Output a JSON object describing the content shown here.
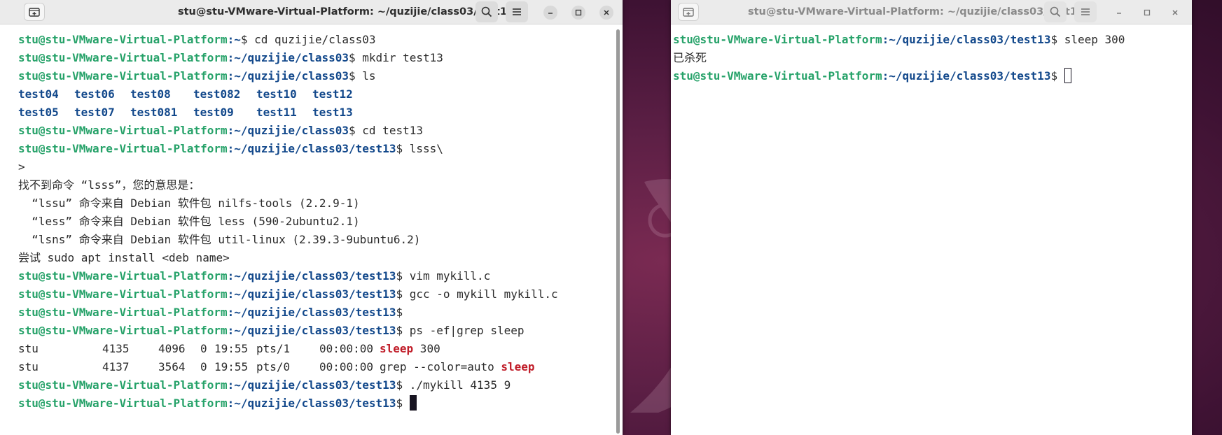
{
  "left_window": {
    "title": "stu@stu-VMware-Virtual-Platform: ~/quzijie/class03/test13",
    "prompt_user": "stu@stu-VMware-Virtual-Platform",
    "lines": {
      "l1_path": ":~",
      "l1_cmd": "$ cd quzijie/class03",
      "l2_path": ":~/quzijie/class03",
      "l2_cmd": "$ mkdir test13",
      "l3_path": ":~/quzijie/class03",
      "l3_cmd": "$ ls",
      "l6_path": ":~/quzijie/class03",
      "l6_cmd": "$ cd test13",
      "l7_path": ":~/quzijie/class03/test13",
      "l7_cmd": "$ lsss\\",
      "l8": ">",
      "l9": "找不到命令 “lsss”，您的意思是：",
      "l10": "  “lssu” 命令来自 Debian 软件包 nilfs-tools (2.2.9-1)",
      "l11": "  “less” 命令来自 Debian 软件包 less (590-2ubuntu2.1)",
      "l12": "  “lsns” 命令来自 Debian 软件包 util-linux (2.39.3-9ubuntu6.2)",
      "l13": "尝试 sudo apt install <deb name>",
      "l14_path": ":~/quzijie/class03/test13",
      "l14_cmd": "$ vim mykill.c",
      "l15_path": ":~/quzijie/class03/test13",
      "l15_cmd": "$ gcc -o mykill mykill.c",
      "l16_path": ":~/quzijie/class03/test13",
      "l16_cmd": "$",
      "l17_path": ":~/quzijie/class03/test13",
      "l17_cmd": "$ ps -ef|grep sleep",
      "l20_path": ":~/quzijie/class03/test13",
      "l20_cmd": "$ ./mykill 4135 9",
      "l21_path": ":~/quzijie/class03/test13",
      "l21_cmd": "$ "
    },
    "ls_output": {
      "row1": [
        "test04",
        "test06",
        "test08",
        "test082",
        "test10",
        "test12"
      ],
      "row2": [
        "test05",
        "test07",
        "test081",
        "test09",
        "test11",
        "test13"
      ]
    },
    "ps_output": [
      {
        "user": "stu",
        "pid": "4135",
        "ppid": "4096",
        "c": "0",
        "stime": "19:55",
        "tty": "pts/1",
        "time": "00:00:00",
        "cmd_pre": "",
        "cmd_hl": "sleep",
        "cmd_post": " 300"
      },
      {
        "user": "stu",
        "pid": "4137",
        "ppid": "3564",
        "c": "0",
        "stime": "19:55",
        "tty": "pts/0",
        "time": "00:00:00",
        "cmd_pre": "grep --color=auto ",
        "cmd_hl": "sleep",
        "cmd_post": ""
      }
    ]
  },
  "right_window": {
    "title": "stu@stu-VMware-Virtual-Platform: ~/quzijie/class03/test13",
    "prompt_user": "stu@stu-VMware-Virtual-Platform",
    "r1_path": ":~/quzijie/class03/test13",
    "r1_cmd": "$ sleep 300",
    "r2": "已杀死",
    "r3_path": ":~/quzijie/class03/test13",
    "r3_cmd": "$ "
  },
  "icons": {
    "new_tab": "new-tab-icon",
    "search": "search-icon",
    "menu": "hamburger-menu-icon",
    "minimize": "minimize-icon",
    "maximize": "maximize-icon",
    "close": "close-icon"
  },
  "colors": {
    "prompt_user": "#26a269",
    "prompt_path": "#12488b",
    "highlight": "#c01c28",
    "text": "#2b2b2b",
    "titlebar": "#ebebeb"
  }
}
